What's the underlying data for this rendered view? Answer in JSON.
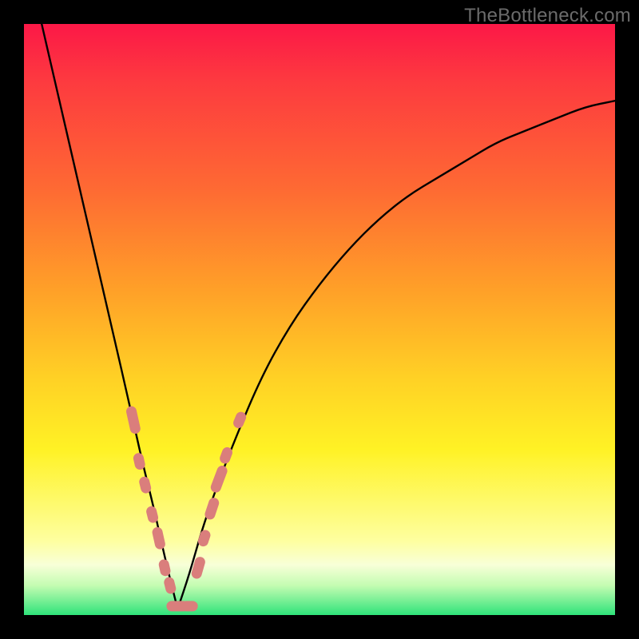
{
  "watermark": "TheBottleneck.com",
  "colors": {
    "curve_stroke": "#000000",
    "marker_fill": "#da7e7c",
    "marker_stroke": "#bb5c5a",
    "gradient_top": "#fc1847",
    "gradient_bottom": "#2fe37a",
    "border": "#000000"
  },
  "chart_data": {
    "type": "line",
    "title": "",
    "xlabel": "",
    "ylabel": "",
    "xlim": [
      0,
      100
    ],
    "ylim": [
      0,
      100
    ],
    "grid": false,
    "legend": false,
    "description": "V-shaped bottleneck curve on rainbow gradient background. y ≈ 100 at left edge, dips to ~0 near x≈26, rises asymptotically to ~87 at right edge. Sample markers cluster near the vertex on both arms.",
    "series": [
      {
        "name": "bottleneck-curve",
        "x": [
          3,
          6,
          9,
          12,
          15,
          18,
          20,
          22,
          24,
          26,
          28,
          30,
          32,
          35,
          40,
          45,
          50,
          55,
          60,
          65,
          70,
          75,
          80,
          85,
          90,
          95,
          100
        ],
        "y": [
          100,
          87,
          74,
          61,
          48,
          35,
          26,
          18,
          9,
          1,
          7,
          14,
          20,
          28,
          40,
          49,
          56,
          62,
          67,
          71,
          74,
          77,
          80,
          82,
          84,
          86,
          87
        ]
      }
    ],
    "markers": {
      "name": "sample-points",
      "shape": "rounded-capsule",
      "points": [
        {
          "x": 18.5,
          "y": 33,
          "len": 5
        },
        {
          "x": 19.5,
          "y": 26,
          "len": 3
        },
        {
          "x": 20.5,
          "y": 22,
          "len": 3
        },
        {
          "x": 21.7,
          "y": 17,
          "len": 3
        },
        {
          "x": 22.8,
          "y": 13,
          "len": 4
        },
        {
          "x": 23.8,
          "y": 8,
          "len": 3
        },
        {
          "x": 24.7,
          "y": 5,
          "len": 3
        },
        {
          "x": 26.0,
          "y": 1.5,
          "len": 4
        },
        {
          "x": 28.0,
          "y": 1.5,
          "len": 3
        },
        {
          "x": 29.5,
          "y": 8,
          "len": 4
        },
        {
          "x": 30.5,
          "y": 13,
          "len": 3
        },
        {
          "x": 31.8,
          "y": 18,
          "len": 4
        },
        {
          "x": 33.0,
          "y": 23,
          "len": 5
        },
        {
          "x": 34.2,
          "y": 27,
          "len": 3
        },
        {
          "x": 36.5,
          "y": 33,
          "len": 3
        }
      ]
    }
  }
}
